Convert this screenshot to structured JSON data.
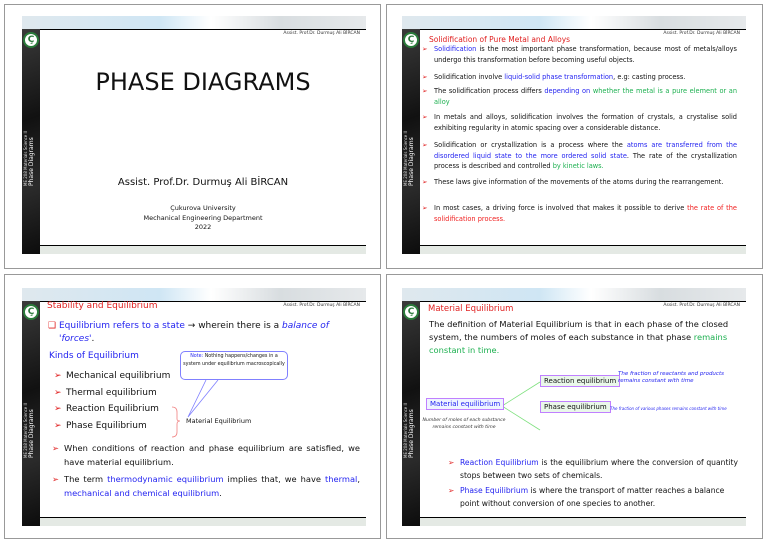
{
  "common": {
    "author": "Assist. Prof.Dr. Durmuş Ali BİRCAN",
    "course": "ME 208 Materials Science II",
    "course_topic": "Phase Diagrams",
    "logo": "university-seal"
  },
  "slide1": {
    "title": "PHASE DIAGRAMS",
    "author": "Assist. Prof.Dr. Durmuş Ali BİRCAN",
    "university": "Çukurova University",
    "department": "Mechanical Engineering Department",
    "year": "2022"
  },
  "slide2": {
    "title": "Solidification of Pure Metal and Alloys",
    "b1": {
      "a": "Solidification",
      "b": " is the most important phase transformation, because most of metals/alloys undergo this transformation before becoming useful objects."
    },
    "b2": {
      "a": "Solidification involve ",
      "b": "liquid-solid phase transformation",
      ",c": "",
      "c": ", e.g: casting process."
    },
    "b3": {
      "a": "The solidification process differs ",
      "b": "depending on ",
      "c": "whether the metal is a pure element or an alloy"
    },
    "b4": "In metals and alloys, solidification involves the formation of crystals, a crystalise solid exhibiting regularity in atomic spacing over a considerable distance.",
    "b5": {
      "a": "Solidification or crystallization is a process where the ",
      "b": "atoms are transferred from the disordered liquid state to the more ordered solid state",
      "c": ". The rate of the crystallization process is described and controlled ",
      "d": "by kinetic laws."
    },
    "b6": "These laws give information of the movements of the atoms during the rearrangement.",
    "b7": {
      "a": "In most cases, a driving force is involved that makes it possible to derive ",
      "b": "the rate of the solidification process."
    }
  },
  "slide3": {
    "title": "Stability and Equilibrium",
    "intro": {
      "a": "Equilibrium refers to a state ",
      "arrow": "→",
      "b": " wherein there is a ",
      "c": "balance of 'forces'",
      "d": "."
    },
    "kinds_heading": "Kinds of Equilibrium",
    "kinds": [
      "Mechanical equilibrium",
      "Thermal equilibrium",
      "Reaction Equilibrium",
      "Phase Equilibrium"
    ],
    "note_label": "Note:",
    "note_text": " Nothing happens/changes in a system under equilibrium macroscopically",
    "brace_label": "Material Equilibrium",
    "b1": "When conditions of reaction and phase equilibrium are satisfied, we have material equilibrium.",
    "b2": {
      "a": "The term ",
      "b": "thermodynamic equilibrium",
      "c": " implies that, we have ",
      "d": "thermal",
      "e": ", ",
      "f": "mechanical and chemical equilibrium",
      "g": "."
    }
  },
  "slide4": {
    "title": "Material Equilibrium",
    "def": {
      "a": "The definition of Material Equilibrium is that in each phase of the closed system, the numbers of moles of each substance in that phase ",
      "b": "remains constant in time."
    },
    "root": "Material equilibrium",
    "root_note": "Number of moles of each substance remains constant with time",
    "reaction": "Reaction equilibrium",
    "reaction_note": "The fraction of reactants and products remains constant with time",
    "phase": "Phase equilibrium",
    "phase_note": "The fraction of various phases remains constant with time",
    "b1": {
      "a": "Reaction Equilibrium",
      "b": " is the equilibrium where the conversion of quantity stops between two sets of chemicals."
    },
    "b2": {
      "a": "Phase Equilibrium",
      "b": " is where the transport of matter reaches a balance point without conversion of one species to another."
    }
  }
}
